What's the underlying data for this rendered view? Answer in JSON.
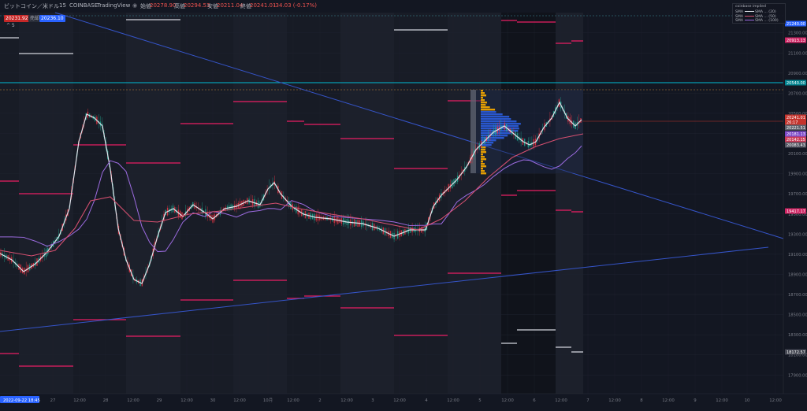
{
  "header": {
    "symbol": "ビットコイン／米ドル",
    "interval": "15",
    "exchange": "COINBASE",
    "brand": "TradingView",
    "open_label": "始値",
    "open": "20278.90",
    "high_label": "高値",
    "high": "20294.53",
    "low_label": "安値",
    "low": "20211.04",
    "close_label": "終値",
    "close": "20241.01",
    "change": "-34.03 (-0.17%)",
    "sell_price": "20231.92",
    "sell_label": "売却",
    "buy_price": "20236.10",
    "toggle": "^ 5"
  },
  "legend": {
    "title": "coinbase implied",
    "rows": [
      {
        "tag": "SMA",
        "text": "SMA ... (20)",
        "color": "#e0e3eb"
      },
      {
        "tag": "SMA",
        "text": "SMA ... (50)",
        "color": "#d44f6f"
      },
      {
        "tag": "SMA",
        "text": "SMA ... (100)",
        "color": "#9c6be0"
      }
    ]
  },
  "price_axis": {
    "ticks": [
      "21300.00",
      "21100.00",
      "20900.00",
      "20700.00",
      "20500.00",
      "20300.00",
      "20100.00",
      "19900.00",
      "19700.00",
      "19500.00",
      "19300.00",
      "19100.00",
      "18900.00",
      "18700.00",
      "18500.00",
      "18300.00",
      "18100.00",
      "17900.00"
    ],
    "labels": [
      {
        "text": "21240.00",
        "color": "#2962ff"
      },
      {
        "text": "20913.13",
        "color": "#cf2463"
      },
      {
        "text": "20540.00",
        "color": "#00838f"
      },
      {
        "text": "20241.01",
        "color": "#c4342d"
      },
      {
        "text": "26:17",
        "color": "#c4342d"
      },
      {
        "text": "20221.51",
        "color": "#5d606b"
      },
      {
        "text": "20181.13",
        "color": "#7b47c8"
      },
      {
        "text": "20142.15",
        "color": "#c93a56"
      },
      {
        "text": "20083.43",
        "color": "#525561"
      },
      {
        "text": "19417.17",
        "color": "#cf2463"
      },
      {
        "text": "18172.57",
        "color": "#434651"
      }
    ]
  },
  "time_axis": {
    "labels": [
      "27",
      "12:00",
      "28",
      "12:00",
      "29",
      "12:00",
      "30",
      "12:00",
      "10月",
      "12:00",
      "2",
      "12:00",
      "3",
      "12:00",
      "4",
      "12:00",
      "5",
      "12:00",
      "6",
      "12:00",
      "7",
      "12:00",
      "8",
      "12:00",
      "9",
      "12:00",
      "10",
      "12:00"
    ],
    "cursor": "2022-09-22  18:45"
  },
  "colors": {
    "background": "#131722",
    "price_line": "#e0e3eb",
    "sma_red": "#d44f6f",
    "sma_purple": "#9c6be0",
    "trend_line": "#2962ff",
    "level_pink": "#e91e63",
    "level_cyan": "#00bcd4",
    "volume_profile": "#f0a500"
  }
}
